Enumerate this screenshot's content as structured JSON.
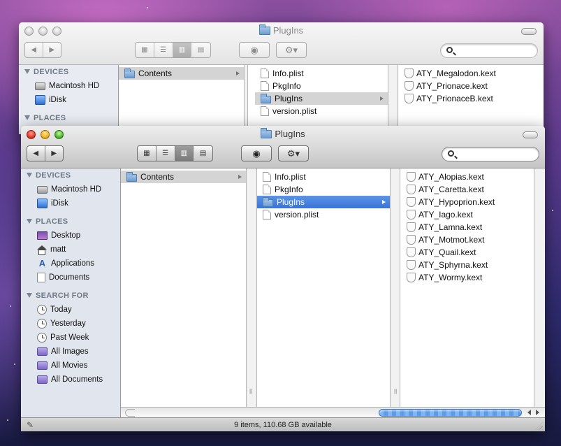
{
  "back_window": {
    "title": "PlugIns",
    "sidebar": {
      "devices_header": "DEVICES",
      "devices": [
        {
          "label": "Macintosh HD",
          "icon": "hard-drive-icon"
        },
        {
          "label": "iDisk",
          "icon": "idisk-icon"
        }
      ],
      "places_header": "PLACES"
    },
    "columns": {
      "col1": [
        {
          "label": "Contents",
          "type": "folder"
        }
      ],
      "col2": [
        {
          "label": "Info.plist",
          "type": "file"
        },
        {
          "label": "PkgInfo",
          "type": "file"
        },
        {
          "label": "PlugIns",
          "type": "folder"
        },
        {
          "label": "version.plist",
          "type": "file"
        }
      ],
      "col3": [
        {
          "label": "ATY_Megalodon.kext"
        },
        {
          "label": "ATY_Prionace.kext"
        },
        {
          "label": "ATY_PrionaceB.kext"
        }
      ]
    }
  },
  "front_window": {
    "title": "PlugIns",
    "sidebar": {
      "devices_header": "DEVICES",
      "devices": [
        {
          "label": "Macintosh HD",
          "icon": "hard-drive-icon"
        },
        {
          "label": "iDisk",
          "icon": "idisk-icon"
        }
      ],
      "places_header": "PLACES",
      "places": [
        {
          "label": "Desktop",
          "icon": "desktop-icon"
        },
        {
          "label": "matt",
          "icon": "home-icon"
        },
        {
          "label": "Applications",
          "icon": "applications-icon"
        },
        {
          "label": "Documents",
          "icon": "documents-icon"
        }
      ],
      "search_header": "SEARCH FOR",
      "searches": [
        {
          "label": "Today",
          "icon": "clock-icon"
        },
        {
          "label": "Yesterday",
          "icon": "clock-icon"
        },
        {
          "label": "Past Week",
          "icon": "clock-icon"
        },
        {
          "label": "All Images",
          "icon": "smart-folder-icon"
        },
        {
          "label": "All Movies",
          "icon": "smart-folder-icon"
        },
        {
          "label": "All Documents",
          "icon": "smart-folder-icon"
        }
      ]
    },
    "columns": {
      "col1": [
        {
          "label": "Contents",
          "type": "folder"
        }
      ],
      "col2": [
        {
          "label": "Info.plist",
          "type": "file"
        },
        {
          "label": "PkgInfo",
          "type": "file"
        },
        {
          "label": "PlugIns",
          "type": "folder"
        },
        {
          "label": "version.plist",
          "type": "file"
        }
      ],
      "col3": [
        {
          "label": "ATY_Alopias.kext"
        },
        {
          "label": "ATY_Caretta.kext"
        },
        {
          "label": "ATY_Hypoprion.kext"
        },
        {
          "label": "ATY_Iago.kext"
        },
        {
          "label": "ATY_Lamna.kext"
        },
        {
          "label": "ATY_Motmot.kext"
        },
        {
          "label": "ATY_Quail.kext"
        },
        {
          "label": "ATY_Sphyrna.kext"
        },
        {
          "label": "ATY_Wormy.kext"
        }
      ]
    },
    "status": "9 items, 110.68 GB available",
    "column_resize_glyph": "||"
  },
  "colors": {
    "selection_blue": "#3a73d6",
    "selection_grey": "#d4d4d4",
    "sidebar_bg": "#e1e6ee",
    "sidebar_header": "#6f7987"
  }
}
